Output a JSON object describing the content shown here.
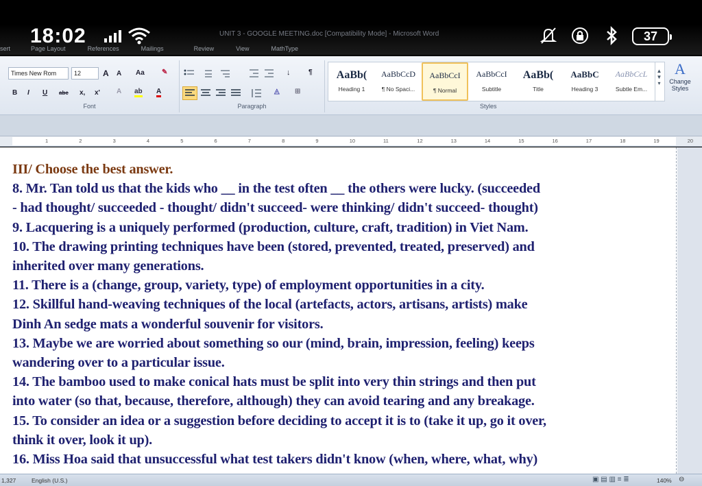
{
  "phone_status": {
    "time": "18:02",
    "battery": "37",
    "icons": [
      "signal-icon",
      "wifi-icon",
      "mute-icon",
      "rotation-lock-icon",
      "bluetooth-icon"
    ]
  },
  "window": {
    "title": "UNIT 3 - GOOGLE MEETING.doc [Compatibility Mode] - Microsoft Word"
  },
  "menu": [
    "sert",
    "Page Layout",
    "References",
    "Mailings",
    "Review",
    "View",
    "MathType"
  ],
  "ribbon": {
    "font": {
      "name": "Times New Rom",
      "size": "12",
      "grow": "A",
      "shrink": "A",
      "case": "Aa",
      "bold": "B",
      "italic": "I",
      "underline": "U",
      "strike": "abe",
      "subscript": "x,",
      "superscript": "x'",
      "label": "Font"
    },
    "paragraph": {
      "label": "Paragraph"
    },
    "styles": {
      "label": "Styles",
      "items": [
        {
          "preview": "AaBb(",
          "name": "Heading 1"
        },
        {
          "preview": "AaBbCcD",
          "name": "¶ No Spaci..."
        },
        {
          "preview": "AaBbCcI",
          "name": "¶ Normal"
        },
        {
          "preview": "AaBbCcI",
          "name": "Subtitle"
        },
        {
          "preview": "AaBb(",
          "name": "Title"
        },
        {
          "preview": "AaBbC",
          "name": "Heading 3"
        },
        {
          "preview": "AaBbCcL",
          "name": "Subtle Em..."
        }
      ],
      "change_label": "Change Styles"
    }
  },
  "ruler": [
    "1",
    "2",
    "3",
    "4",
    "5",
    "6",
    "7",
    "8",
    "9",
    "10",
    "11",
    "12",
    "13",
    "14",
    "15",
    "16",
    "17",
    "18",
    "19",
    "20"
  ],
  "document": {
    "heading": "III/ Choose the best answer.",
    "lines": [
      "8. Mr. Tan told us that the kids who __ in the test often __ the others were lucky. (succeeded",
      "- had thought/ succeeded - thought/ didn't succeed- were thinking/ didn't succeed- thought)",
      "9. Lacquering is a uniquely performed (production, culture, craft, tradition)  in Viet Nam.",
      "10. The drawing printing techniques have been (stored, prevented, treated, preserved) and",
      "inherited over many generations.",
      "11. There is a (change, group, variety, type) of employment opportunities in a city.",
      "12. Skillful hand-weaving techniques of the local (artefacts, actors, artisans, artists) make",
      "Dinh An sedge mats a wonderful souvenir for visitors.",
      "13. Maybe we are worried  about something so our (mind, brain, impression, feeling) keeps",
      "wandering over to a particular issue.",
      "14. The bamboo used to make conical hats must be split into very thin strings and then put",
      "into water (so that, because, therefore, although) they can avoid tearing and any breakage.",
      "15. To consider an idea or a suggestion before deciding to accept it is to (take it up, go it over,",
      "think it over, look it up).",
      "16. Miss Hoa said that unsuccessful what test takers didn't know (when, where, what, why)"
    ]
  },
  "statusbar": {
    "words": "1,327",
    "language": "English (U.S.)",
    "zoom": "140%"
  }
}
